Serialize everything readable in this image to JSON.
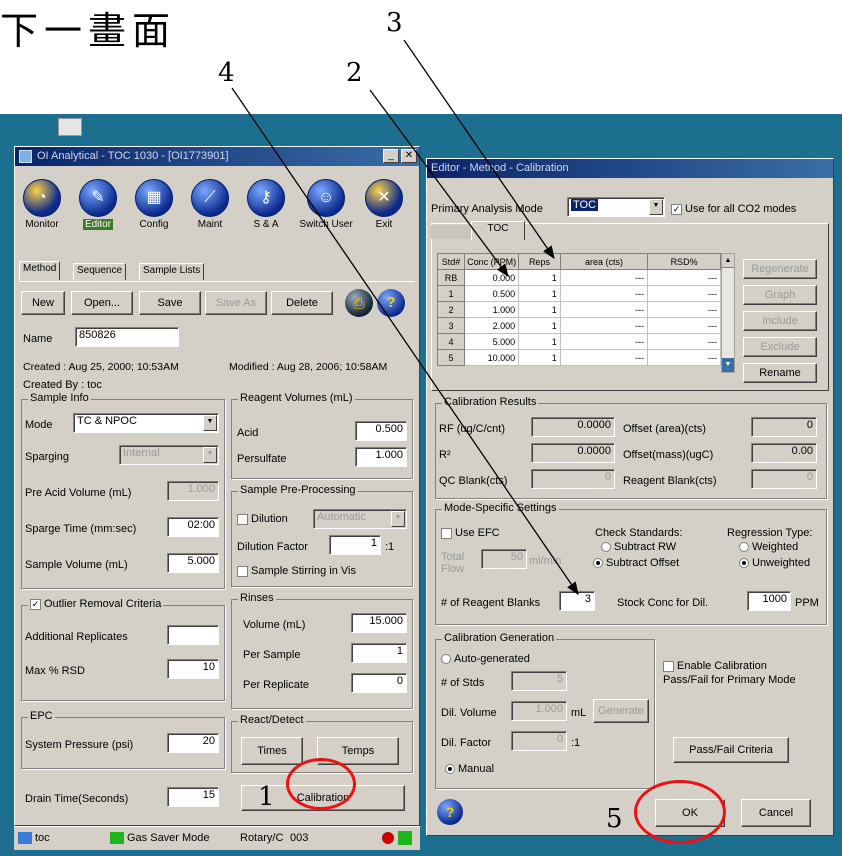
{
  "slide": {
    "title": "下一畫面",
    "annotations": [
      "1",
      "2",
      "3",
      "4",
      "5"
    ]
  },
  "left_window": {
    "title": "OI Analytical - TOC 1030 - [OI1773901]",
    "toolbar": [
      {
        "label": "Monitor",
        "icon": "gauge-icon"
      },
      {
        "label": "Editor",
        "icon": "pencil-icon"
      },
      {
        "label": "Config",
        "icon": "grid-icon"
      },
      {
        "label": "Maint",
        "icon": "screwdriver-icon"
      },
      {
        "label": "S & A",
        "icon": "key-icon"
      },
      {
        "label": "Switch User",
        "icon": "user-icon"
      },
      {
        "label": "Exit",
        "icon": "close-icon"
      }
    ],
    "tabs": [
      "Method",
      "Sequence",
      "Sample Lists"
    ],
    "buttons": {
      "new": "New",
      "open": "Open...",
      "save": "Save",
      "save_as": "Save As",
      "delete": "Delete"
    },
    "name_label": "Name",
    "name_value": "850826",
    "created": "Created : Aug 25, 2000; 10:53AM",
    "modified": "Modified : Aug 28, 2006; 10:58AM",
    "created_by": "Created By : toc",
    "sample_info": {
      "title": "Sample Info",
      "mode_label": "Mode",
      "mode_value": "TC & NPOC",
      "sparging_label": "Sparging",
      "sparging_value": "Internal",
      "pre_acid_label": "Pre Acid Volume (mL)",
      "pre_acid_value": "1.000",
      "sparge_time_label": "Sparge Time (mm:sec)",
      "sparge_time_value": "02:00",
      "sample_volume_label": "Sample Volume (mL)",
      "sample_volume_value": "5.000"
    },
    "reagent": {
      "title": "Reagent Volumes (mL)",
      "acid_label": "Acid",
      "acid_value": "0.500",
      "persulfate_label": "Persulfate",
      "persulfate_value": "1.000"
    },
    "preprocessing": {
      "title": "Sample Pre-Processing",
      "dilution_label": "Dilution",
      "dilution_value": "Automatic",
      "dilution_factor_label": "Dilution Factor",
      "dilution_factor_value": "1",
      "dilution_factor_suffix": ":1",
      "stirring_label": "Sample Stirring in Vis"
    },
    "outlier": {
      "title": "Outlier Removal Criteria",
      "replicates_label": "Additional Replicates",
      "replicates_value": "",
      "rsd_label": "Max % RSD",
      "rsd_value": "10"
    },
    "rinses": {
      "title": "Rinses",
      "volume_label": "Volume (mL)",
      "volume_value": "15.000",
      "per_sample_label": "Per Sample",
      "per_sample_value": "1",
      "per_replicate_label": "Per Replicate",
      "per_replicate_value": "0"
    },
    "epc": {
      "title": "EPC",
      "pressure_label": "System Pressure (psi)",
      "pressure_value": "20"
    },
    "react": {
      "title": "React/Detect",
      "times": "Times",
      "temps": "Temps"
    },
    "drain_label": "Drain Time(Seconds)",
    "drain_value": "15",
    "calibration_button": "Calibration"
  },
  "taskbar": {
    "user": "toc",
    "gas_saver": "Gas Saver Mode",
    "rotary": "Rotary/C",
    "value": "003"
  },
  "right_window": {
    "title": "Editor - Method - Calibration",
    "primary_mode_label": "Primary Analysis Mode",
    "primary_mode_value": "TOC",
    "use_for_all_label": "Use for all CO2 modes",
    "tab": "TOC",
    "table": {
      "headers": [
        "Std#",
        "Conc (PPM)",
        "Reps",
        "area (cts)",
        "RSD%"
      ],
      "rows": [
        [
          "RB",
          "0.000",
          "1",
          "---",
          "---"
        ],
        [
          "1",
          "0.500",
          "1",
          "---",
          "---"
        ],
        [
          "2",
          "1.000",
          "1",
          "---",
          "---"
        ],
        [
          "3",
          "2.000",
          "1",
          "---",
          "---"
        ],
        [
          "4",
          "5.000",
          "1",
          "---",
          "---"
        ],
        [
          "5",
          "10.000",
          "1",
          "---",
          "---"
        ]
      ]
    },
    "side_buttons": [
      "Regenerate",
      "Graph",
      "Include",
      "Exclude",
      "Rename"
    ],
    "results": {
      "title": "Calibration Results",
      "rf_label": "RF (ug/C/cnt)",
      "rf_value": "0.0000",
      "r2_label": "R²",
      "r2_value": "0.0000",
      "qc_label": "QC Blank(cts)",
      "qc_value": "0",
      "offset_area_label": "Offset (area)(cts)",
      "offset_area_value": "0",
      "offset_mass_label": "Offset(mass)(ugC)",
      "offset_mass_value": "0.00",
      "reagent_blank_label": "Reagent Blank(cts)",
      "reagent_blank_value": "0"
    },
    "mode_settings": {
      "title": "Mode-Specific Settings",
      "use_efc": "Use EFC",
      "total_flow_label": "Total Flow",
      "total_flow_value": "50",
      "total_flow_unit": "ml/min",
      "check_standards_label": "Check Standards:",
      "subtract_rw": "Subtract RW",
      "subtract_offset": "Subtract Offset",
      "regression_label": "Regression Type:",
      "weighted": "Weighted",
      "unweighted": "Unweighted",
      "reagent_blanks_label": "# of Reagent Blanks",
      "reagent_blanks_value": "3",
      "stock_conc_label": "Stock Conc for Dil.",
      "stock_conc_value": "1000",
      "stock_conc_unit": "PPM"
    },
    "generation": {
      "title": "Calibration Generation",
      "auto": "Auto-generated",
      "num_stds_label": "# of Stds",
      "num_stds_value": "5",
      "dil_volume_label": "Dil. Volume",
      "dil_volume_value": "1.000",
      "dil_volume_unit": "mL",
      "generate": "Generate",
      "dil_factor_label": "Dil. Factor",
      "dil_factor_value": "0",
      "dil_factor_suffix": ":1",
      "manual": "Manual"
    },
    "enable_pass_fail": "Enable Calibration Pass/Fail for Primary Mode",
    "pass_fail_criteria": "Pass/Fail Criteria",
    "ok": "OK",
    "cancel": "Cancel"
  },
  "colors": {
    "annotation_circle": "#e11111",
    "title_bar": "#0a246a",
    "desktop": "#1c6f8e"
  }
}
